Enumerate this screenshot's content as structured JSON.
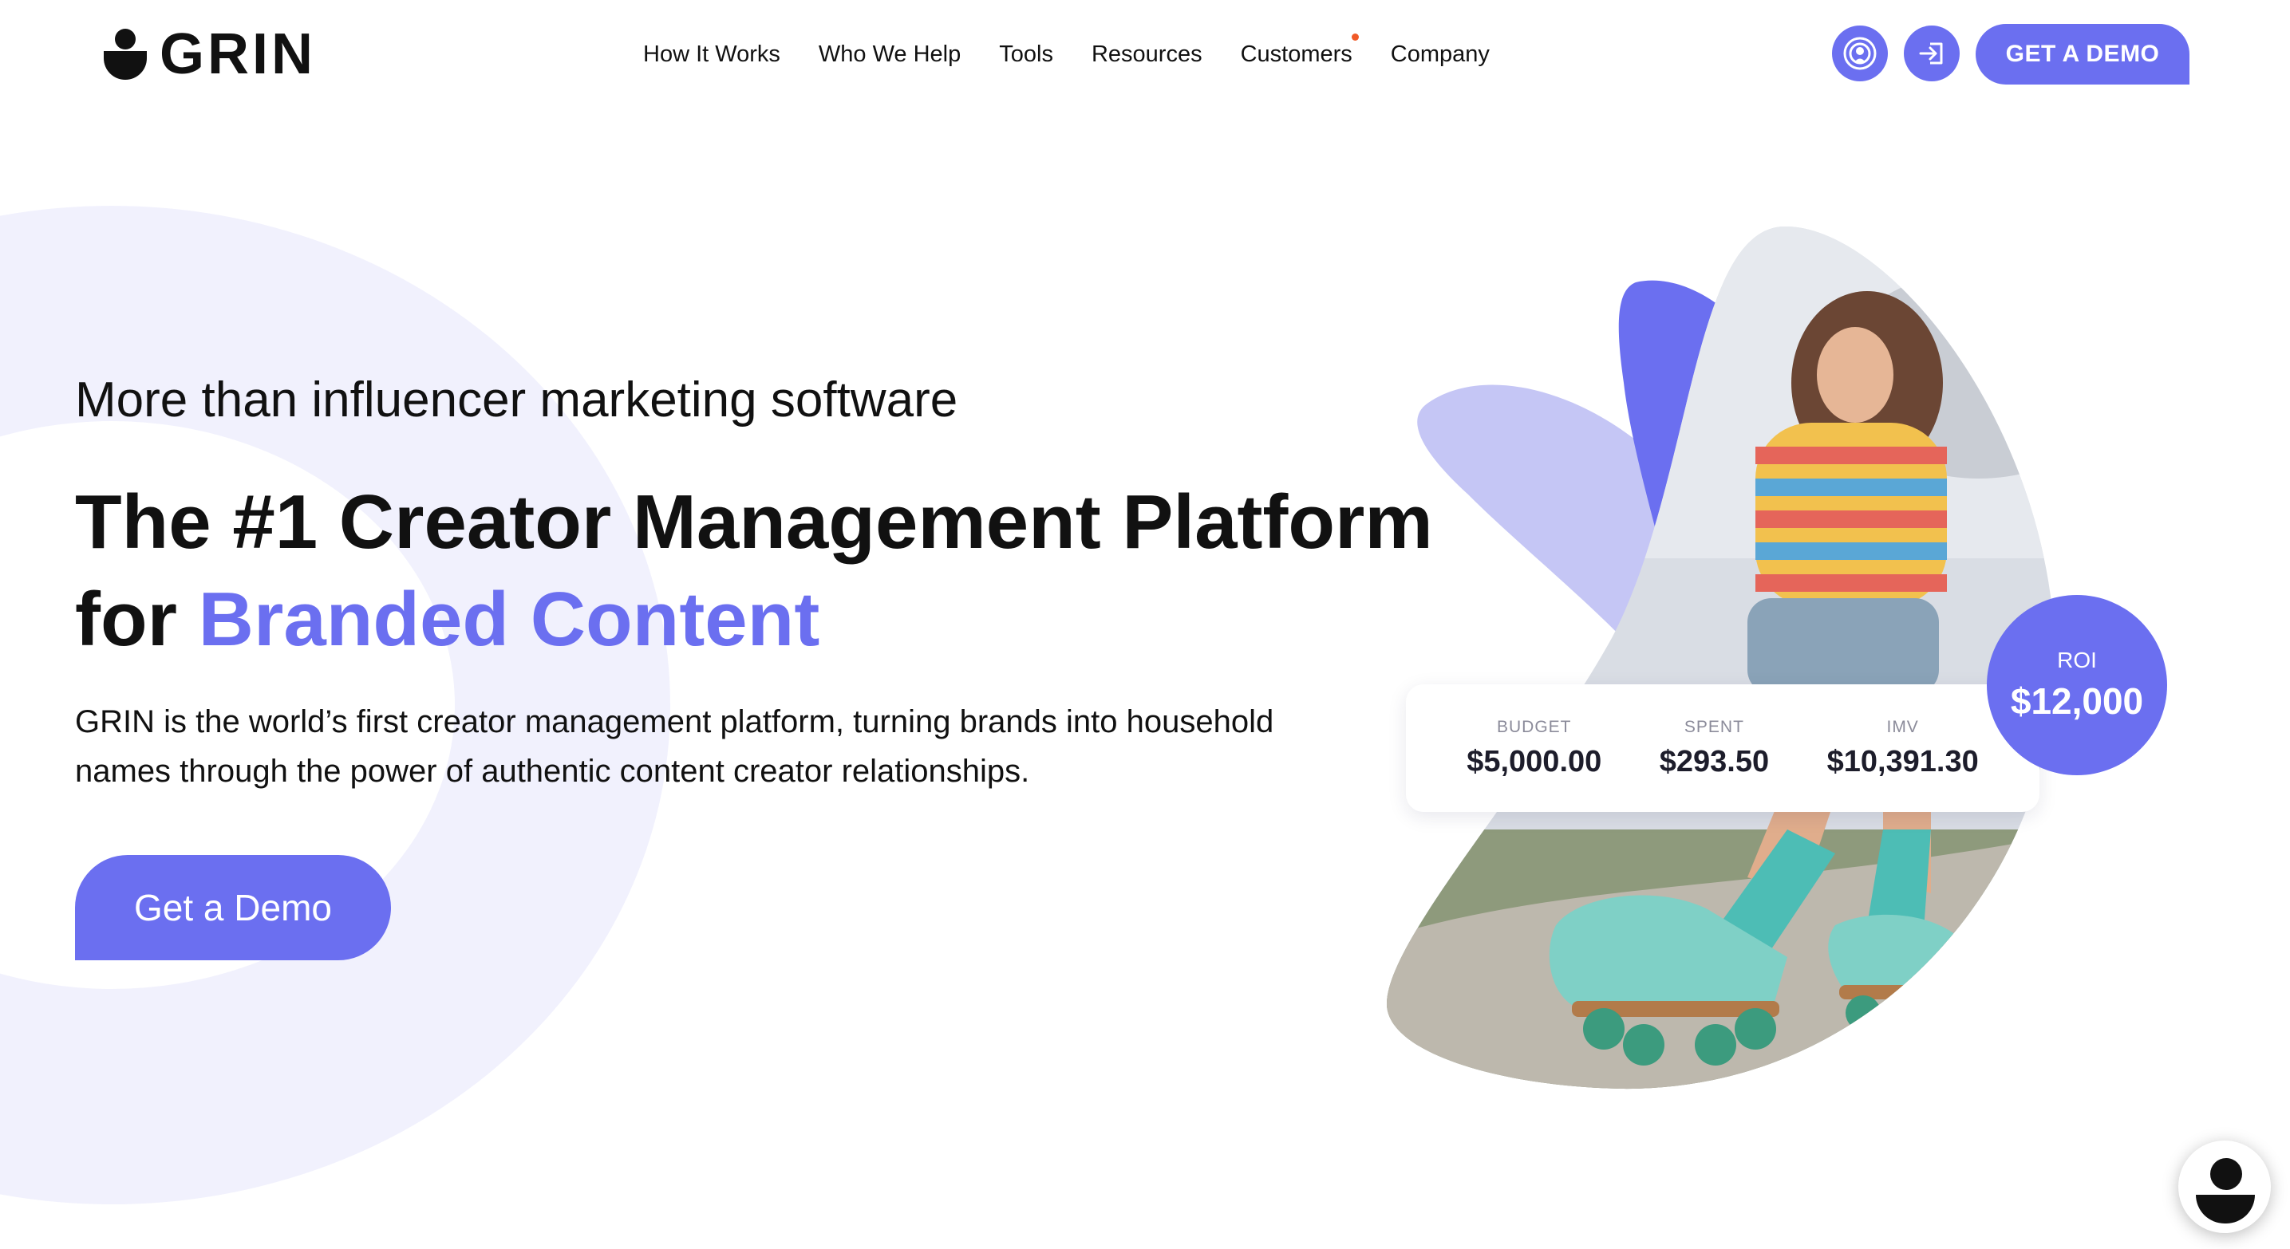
{
  "header": {
    "logo_text": "GRIN",
    "nav": [
      {
        "label": "How It Works"
      },
      {
        "label": "Who We Help"
      },
      {
        "label": "Tools"
      },
      {
        "label": "Resources"
      },
      {
        "label": "Customers"
      },
      {
        "label": "Company"
      }
    ],
    "icons": [
      "podcast-icon",
      "login-icon"
    ],
    "cta_label": "GET A DEMO",
    "accent_color": "#6b6ff0"
  },
  "hero": {
    "kicker": "More than influencer marketing software",
    "headline_line1": "The #1 Creator Management Platform",
    "headline_for": "for ",
    "headline_accent": "Branded Content",
    "description": "GRIN is the world’s first creator management platform, turning brands into household names through the power of authentic content creator relationships.",
    "cta_label": "Get a Demo"
  },
  "stats": [
    {
      "label": "BUDGET",
      "value": "$5,000.00"
    },
    {
      "label": "SPENT",
      "value": "$293.50"
    },
    {
      "label": "IMV",
      "value": "$10,391.30"
    }
  ],
  "roi": {
    "label": "ROI",
    "value": "$12,000"
  },
  "chat": {
    "icon": "chat-launcher-icon"
  }
}
